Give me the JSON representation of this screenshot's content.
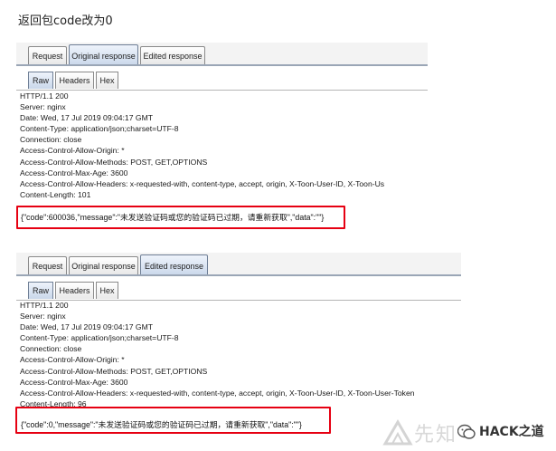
{
  "heading": "返回包code改为0",
  "panels": [
    {
      "tabs": [
        "Request",
        "Original response",
        "Edited response"
      ],
      "active_tab": "Original response",
      "subtabs": [
        "Raw",
        "Headers",
        "Hex"
      ],
      "active_subtab": "Raw",
      "lines": [
        "HTTP/1.1 200",
        "Server: nginx",
        "Date: Wed, 17 Jul 2019 09:04:17 GMT",
        "Content-Type: application/json;charset=UTF-8",
        "Connection: close",
        "Access-Control-Allow-Origin: *",
        "Access-Control-Allow-Methods: POST, GET,OPTIONS",
        "Access-Control-Max-Age: 3600",
        "Access-Control-Allow-Headers: x-requested-with, content-type, accept, origin, X-Toon-User-ID, X-Toon-Us",
        "Content-Length: 101"
      ],
      "body": "{\"code\":600036,\"message\":\"未发送验证码或您的验证码已过期，请重新获取\",\"data\":\"\"}"
    },
    {
      "tabs": [
        "Request",
        "Original response",
        "Edited response"
      ],
      "active_tab": "Edited response",
      "subtabs": [
        "Raw",
        "Headers",
        "Hex"
      ],
      "active_subtab": "Raw",
      "lines": [
        "HTTP/1.1 200",
        "Server: nginx",
        "Date: Wed, 17 Jul 2019 09:04:17 GMT",
        "Content-Type: application/json;charset=UTF-8",
        "Connection: close",
        "Access-Control-Allow-Origin: *",
        "Access-Control-Allow-Methods: POST, GET,OPTIONS",
        "Access-Control-Max-Age: 3600",
        "Access-Control-Allow-Headers: x-requested-with, content-type, accept, origin, X-Toon-User-ID, X-Toon-User-Token",
        "Content-Length: 96"
      ],
      "body": "{\"code\":0,\"message\":\"未发送验证码或您的验证码已过期，请重新获取\",\"data\":\"\"}"
    }
  ],
  "watermark": {
    "left_text": "先知",
    "right_text": "HACK之道"
  },
  "colors": {
    "highlight": "#e60012",
    "tab_active": "#c9d7ea",
    "tab_border": "#8a8a8a"
  }
}
